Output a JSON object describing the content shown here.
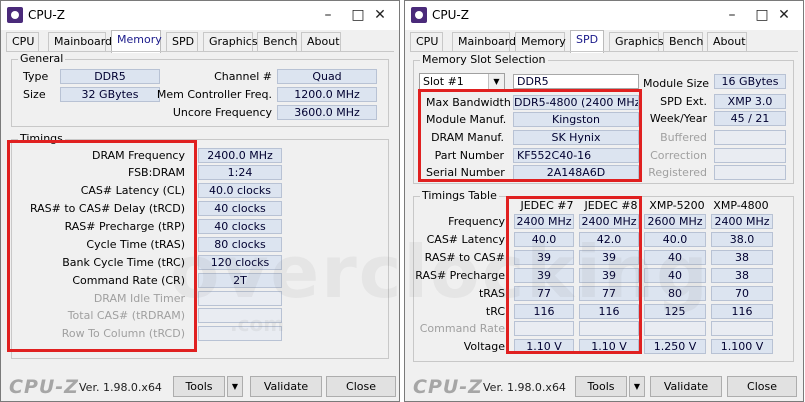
{
  "windows": {
    "left": {
      "title": "CPU-Z",
      "tabs": [
        "CPU",
        "Mainboard",
        "Memory",
        "SPD",
        "Graphics",
        "Bench",
        "About"
      ],
      "active_tab": "Memory",
      "general": {
        "title": "General",
        "type_label": "Type",
        "type_value": "DDR5",
        "size_label": "Size",
        "size_value": "32 GBytes",
        "channel_label": "Channel #",
        "channel_value": "Quad",
        "mem_ctrl_label": "Mem Controller Freq.",
        "mem_ctrl_value": "1200.0 MHz",
        "uncore_label": "Uncore Frequency",
        "uncore_value": "3600.0 MHz"
      },
      "timings": {
        "title": "Timings",
        "rows": [
          {
            "label": "DRAM Frequency",
            "value": "2400.0 MHz"
          },
          {
            "label": "FSB:DRAM",
            "value": "1:24"
          },
          {
            "label": "CAS# Latency (CL)",
            "value": "40.0 clocks"
          },
          {
            "label": "RAS# to CAS# Delay (tRCD)",
            "value": "40 clocks"
          },
          {
            "label": "RAS# Precharge (tRP)",
            "value": "40 clocks"
          },
          {
            "label": "Cycle Time (tRAS)",
            "value": "80 clocks"
          },
          {
            "label": "Bank Cycle Time (tRC)",
            "value": "120 clocks"
          },
          {
            "label": "Command Rate (CR)",
            "value": "2T"
          },
          {
            "label": "DRAM Idle Timer",
            "value": ""
          },
          {
            "label": "Total CAS# (tRDRAM)",
            "value": ""
          },
          {
            "label": "Row To Column (tRCD)",
            "value": ""
          }
        ]
      },
      "footer": {
        "brand": "CPU-Z",
        "version": "Ver. 1.98.0.x64",
        "tools": "Tools",
        "validate": "Validate",
        "close": "Close"
      }
    },
    "right": {
      "title": "CPU-Z",
      "tabs": [
        "CPU",
        "Mainboard",
        "Memory",
        "SPD",
        "Graphics",
        "Bench",
        "About"
      ],
      "active_tab": "SPD",
      "slot": {
        "title": "Memory Slot Selection",
        "selected": "Slot #1",
        "type_value": "DDR5",
        "module_size_label": "Module Size",
        "module_size_value": "16 GBytes",
        "spd_ext_label": "SPD Ext.",
        "spd_ext_value": "XMP 3.0",
        "week_year_label": "Week/Year",
        "week_year_value": "45 / 21",
        "buffered_label": "Buffered",
        "correction_label": "Correction",
        "registered_label": "Registered",
        "rows": [
          {
            "label": "Max Bandwidth",
            "value": "DDR5-4800 (2400 MHz)"
          },
          {
            "label": "Module Manuf.",
            "value": "Kingston"
          },
          {
            "label": "DRAM Manuf.",
            "value": "SK Hynix"
          },
          {
            "label": "Part Number",
            "value": "KF552C40-16"
          },
          {
            "label": "Serial Number",
            "value": "2A148A6D"
          }
        ]
      },
      "timings_table": {
        "title": "Timings Table",
        "columns": [
          "JEDEC #7",
          "JEDEC #8",
          "XMP-5200",
          "XMP-4800"
        ],
        "rows": [
          {
            "label": "Frequency",
            "values": [
              "2400 MHz",
              "2400 MHz",
              "2600 MHz",
              "2400 MHz"
            ]
          },
          {
            "label": "CAS# Latency",
            "values": [
              "40.0",
              "42.0",
              "40.0",
              "38.0"
            ]
          },
          {
            "label": "RAS# to CAS#",
            "values": [
              "39",
              "39",
              "40",
              "38"
            ]
          },
          {
            "label": "RAS# Precharge",
            "values": [
              "39",
              "39",
              "40",
              "38"
            ]
          },
          {
            "label": "tRAS",
            "values": [
              "77",
              "77",
              "80",
              "70"
            ]
          },
          {
            "label": "tRC",
            "values": [
              "116",
              "116",
              "125",
              "116"
            ]
          },
          {
            "label": "Command Rate",
            "values": [
              "",
              "",
              "",
              ""
            ]
          },
          {
            "label": "Voltage",
            "values": [
              "1.10 V",
              "1.10 V",
              "1.250 V",
              "1.100 V"
            ]
          }
        ]
      },
      "footer": {
        "brand": "CPU-Z",
        "version": "Ver. 1.98.0.x64",
        "tools": "Tools",
        "validate": "Validate",
        "close": "Close"
      }
    }
  },
  "watermark": "overclocking",
  "watermark_sub": ".com",
  "colors": {
    "highlight_box": "#e02020",
    "value_field": "#dce4f0"
  }
}
